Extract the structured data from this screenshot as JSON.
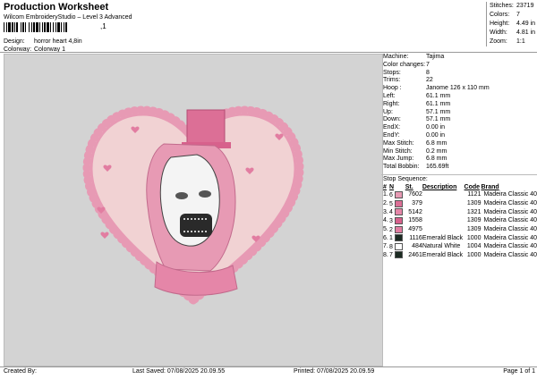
{
  "header": {
    "title": "Production Worksheet",
    "subtitle": "Wilcom EmbroideryStudio – Level 3 Advanced",
    "barcode_suffix": ",1",
    "design_label": "Design:",
    "design_value": "horror heart 4,8in",
    "colorway_label": "Colorway:",
    "colorway_value": "Colorway 1"
  },
  "top_stats": [
    {
      "label": "Stitches:",
      "value": "23719"
    },
    {
      "label": "Colors:",
      "value": "7"
    },
    {
      "label": "Height:",
      "value": "4.49 in"
    },
    {
      "label": "Width:",
      "value": "4.81 in"
    },
    {
      "label": "Zoom:",
      "value": "1:1"
    }
  ],
  "machine_info": [
    {
      "label": "Machine:",
      "value": "Tajima"
    },
    {
      "label": "Color changes:",
      "value": "7"
    },
    {
      "label": "Stops:",
      "value": "8"
    },
    {
      "label": "Trims:",
      "value": "22"
    },
    {
      "label": "Hoop :",
      "value": "Janome 126 x 110 mm"
    },
    {
      "label": "Left:",
      "value": "61.1 mm"
    },
    {
      "label": "Right:",
      "value": "61.1 mm"
    },
    {
      "label": "Up:",
      "value": "57.1 mm"
    },
    {
      "label": "Down:",
      "value": "57.1 mm"
    },
    {
      "label": "EndX:",
      "value": "0.00 in"
    },
    {
      "label": "EndY:",
      "value": "0.00 in"
    },
    {
      "label": "Max Stitch:",
      "value": "6.8 mm"
    },
    {
      "label": "Min Stitch:",
      "value": "0.2 mm"
    },
    {
      "label": "Max Jump:",
      "value": "6.8 mm"
    },
    {
      "label": "Total Bobbin:",
      "value": "165.69ft"
    }
  ],
  "stop_sequence": {
    "title": "Stop Sequence:",
    "headers": [
      "#",
      "N",
      "St.",
      "Description",
      "Code",
      "Brand"
    ],
    "rows": [
      {
        "n": "1.",
        "code_no": "6",
        "color": "#e79ab4",
        "st": "7602",
        "desc": "",
        "code": "1121",
        "brand": "Madeira Classic 40"
      },
      {
        "n": "2.",
        "code_no": "5",
        "color": "#dc6f96",
        "st": "379",
        "desc": "",
        "code": "1309",
        "brand": "Madeira Classic 40"
      },
      {
        "n": "3.",
        "code_no": "4",
        "color": "#e586a8",
        "st": "5142",
        "desc": "",
        "code": "1321",
        "brand": "Madeira Classic 40"
      },
      {
        "n": "4.",
        "code_no": "3",
        "color": "#d7618c",
        "st": "1558",
        "desc": "",
        "code": "1309",
        "brand": "Madeira Classic 40"
      },
      {
        "n": "5.",
        "code_no": "2",
        "color": "#e27da1",
        "st": "4975",
        "desc": "",
        "code": "1309",
        "brand": "Madeira Classic 40"
      },
      {
        "n": "6.",
        "code_no": "1",
        "color": "#1c2b22",
        "st": "1116",
        "desc": "Emerald Black",
        "code": "1000",
        "brand": "Madeira Classic 40"
      },
      {
        "n": "7.",
        "code_no": "8",
        "color": "#ffffff",
        "st": "484",
        "desc": "Natural White",
        "code": "1004",
        "brand": "Madeira Classic 40"
      },
      {
        "n": "8.",
        "code_no": "7",
        "color": "#1c2b22",
        "st": "2461",
        "desc": "Emerald Black",
        "code": "1000",
        "brand": "Madeira Classic 40"
      }
    ]
  },
  "footer": {
    "created_by": "Created By:",
    "last_saved": "Last Saved: 07/08/2025 20.09.55",
    "printed": "Printed: 07/08/2025 20.09.59",
    "page": "Page 1 of 1"
  },
  "colors": {
    "canvas_bg": "#d3d3d3",
    "heart_fill": "#f1d2d3",
    "heart_border": "#e79ab4",
    "mouth": "#2a2a2a"
  }
}
